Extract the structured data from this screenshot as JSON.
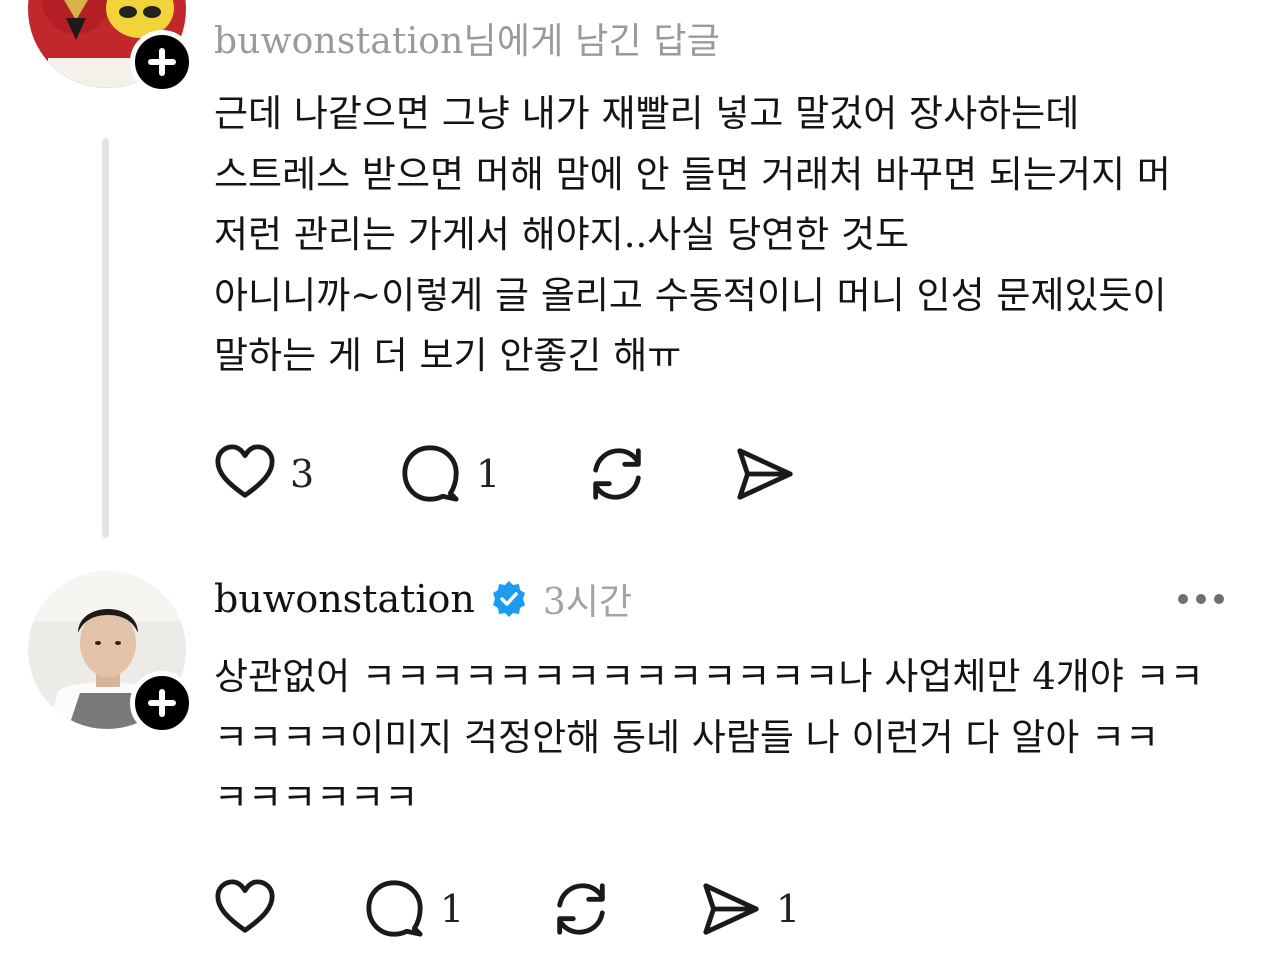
{
  "posts": [
    {
      "reply_to": "buwonstation님에게 남긴 답글",
      "body": "근데 나같으면 그냥 내가 재빨리 넣고 말겄어 장사하는데\n스트레스 받으면 머해 맘에 안 들면 거래처 바꾸면 되는거지 머\n저런 관리는 가게서 해야지..사실 당연한 것도\n아니니까~이렇게 글 올리고 수동적이니 머니 인성 문제있듯이\n말하는 게 더 보기 안좋긴 해ㅠ",
      "likes": "3",
      "comments": "1",
      "reposts": "",
      "shares": ""
    },
    {
      "username": "buwonstation",
      "time": "3시간",
      "body": "상관없어 ㅋㅋㅋㅋㅋㅋㅋㅋㅋㅋㅋㅋㅋㅋ나 사업체만 4개야 ㅋㅋ\nㅋㅋㅋㅋ이미지 걱정안해 동네 사람들 나 이런거 다 알아 ㅋㅋ\nㅋㅋㅋㅋㅋㅋ",
      "likes": "",
      "comments": "1",
      "reposts": "",
      "shares": "1"
    }
  ],
  "icons": {
    "like": "heart-icon",
    "comment": "comment-bubble-icon",
    "repost": "repost-icon",
    "share": "send-icon",
    "follow": "plus-icon",
    "verified": "verified-badge-icon",
    "more": "more-icon"
  },
  "colors": {
    "verified_blue": "#1d9bf0",
    "muted_text": "#9a9a9a",
    "thread_line": "#e4e4e4",
    "text": "#141414"
  }
}
